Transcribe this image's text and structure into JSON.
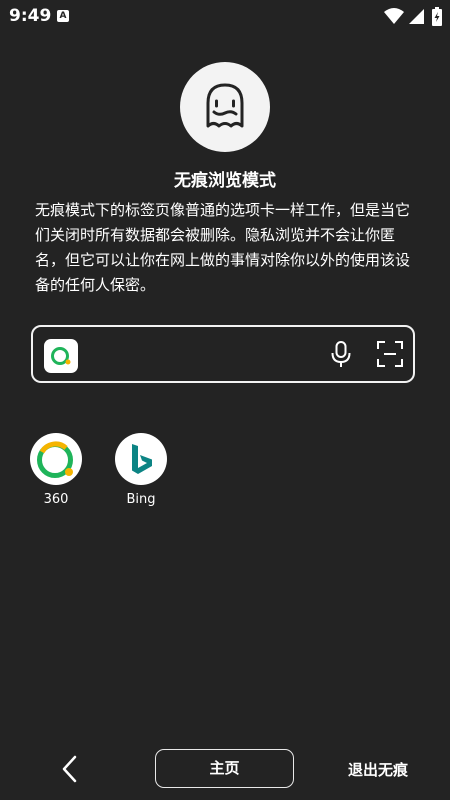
{
  "status_bar": {
    "time": "9:49",
    "notification_badge": "A",
    "icons": [
      "wifi-icon",
      "signal-icon",
      "battery-charging-icon"
    ]
  },
  "incognito": {
    "icon": "ghost-icon",
    "title": "无痕浏览模式",
    "description": "无痕模式下的标签页像普通的选项卡一样工作，但是当它们关闭时所有数据都会被删除。隐私浏览并不会让你匿名，但它可以让你在网上做的事情对除你以外的使用该设备的任何人保密。"
  },
  "search_bar": {
    "engine_icon": "360-search-icon",
    "voice_icon": "mic-icon",
    "scan_icon": "scan-icon"
  },
  "shortcuts": [
    {
      "label": "360",
      "icon": "360-logo-icon"
    },
    {
      "label": "Bing",
      "icon": "bing-logo-icon"
    }
  ],
  "bottom_bar": {
    "back_icon": "back-chevron-icon",
    "home_label": "主页",
    "exit_label": "退出无痕"
  },
  "colors": {
    "background": "#232323",
    "text": "#ffffff",
    "accent_green": "#1fb45a",
    "accent_yellow": "#f5b400",
    "bing_teal": "#0c8484"
  }
}
